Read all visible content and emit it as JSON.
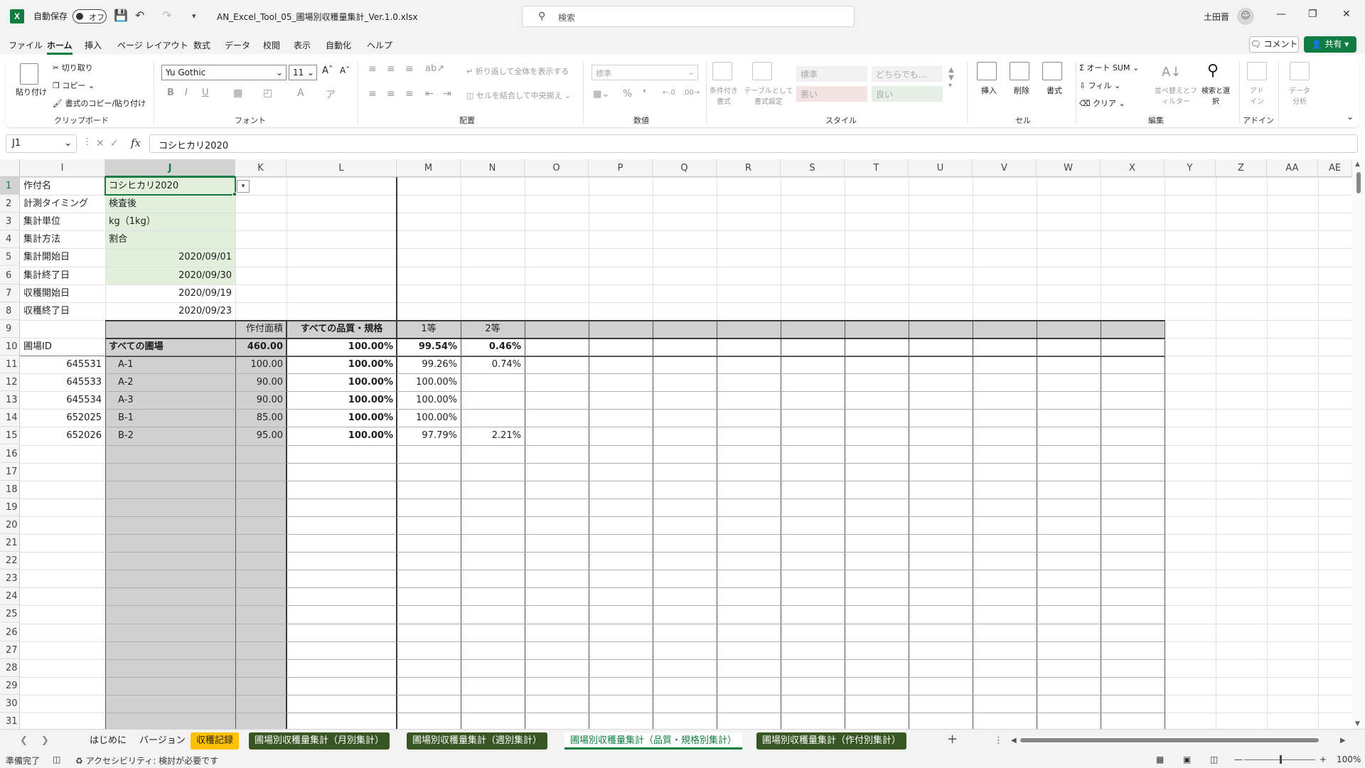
{
  "titlebar": {
    "autosave_label": "自動保存",
    "autosave_state": "オフ",
    "doc_title": "AN_Excel_Tool_05_圃場別収穫量集計_Ver.1.0.xlsx",
    "search_placeholder": "検索",
    "user_name": "土田晋"
  },
  "menu": [
    "ファイル",
    "ホーム",
    "挿入",
    "ページ レイアウト",
    "数式",
    "データ",
    "校閲",
    "表示",
    "自動化",
    "ヘルプ"
  ],
  "menu_active": "ホーム",
  "buttons": {
    "comment": "コメント",
    "share": "共有"
  },
  "ribbon": {
    "clipboard": {
      "paste": "貼り付け",
      "cut": "切り取り",
      "copy": "コピー",
      "format_painter": "書式のコピー/貼り付け",
      "label": "クリップボード"
    },
    "font": {
      "name": "Yu Gothic",
      "size": "11",
      "label": "フォント"
    },
    "alignment": {
      "wrap": "折り返して全体を表示する",
      "merge": "セルを結合して中央揃え",
      "label": "配置"
    },
    "number": {
      "format": "標準",
      "label": "数値"
    },
    "styles": {
      "conditional": "条件付き書式",
      "table": "テーブルとして書式設定",
      "standard": "標準",
      "neutral": "どちらでも...",
      "bad": "悪い",
      "good": "良い",
      "label": "スタイル"
    },
    "cells": {
      "insert": "挿入",
      "delete": "削除",
      "format": "書式",
      "label": "セル"
    },
    "editing": {
      "autosum": "オート SUM",
      "fill": "フィル",
      "clear": "クリア",
      "sort": "並べ替えとフィルター",
      "find": "検索と選択",
      "label": "編集"
    },
    "addins": {
      "addin": "アドイン",
      "label": "アドイン"
    },
    "analysis": {
      "data_analysis": "データ分析"
    }
  },
  "formula_bar": {
    "name_box": "J1",
    "formula": "コシヒカリ2020"
  },
  "columns": [
    "I",
    "J",
    "K",
    "L",
    "M",
    "N",
    "O",
    "P",
    "Q",
    "R",
    "S",
    "T",
    "U",
    "V",
    "W",
    "X",
    "Y",
    "Z",
    "AA",
    "AE"
  ],
  "rows": [
    "1",
    "2",
    "3",
    "4",
    "5",
    "6",
    "7",
    "8",
    "9",
    "10",
    "11",
    "12",
    "13",
    "14",
    "15",
    "16",
    "17",
    "18",
    "19",
    "20",
    "21",
    "22",
    "23",
    "24",
    "25",
    "26",
    "27",
    "28",
    "29",
    "30",
    "31"
  ],
  "sheet": {
    "params": [
      {
        "label": "作付名",
        "value": "コシヒカリ2020"
      },
      {
        "label": "計測タイミング",
        "value": "検査後"
      },
      {
        "label": "集計単位",
        "value": "kg（1kg）"
      },
      {
        "label": "集計方法",
        "value": "割合"
      },
      {
        "label": "集計開始日",
        "value": "2020/09/01"
      },
      {
        "label": "集計終了日",
        "value": "2020/09/30"
      },
      {
        "label": "収穫開始日",
        "value": "2020/09/19"
      },
      {
        "label": "収穫終了日",
        "value": "2020/09/23"
      }
    ],
    "header_row9": {
      "area": "作付面積",
      "all_quality": "すべての品質・規格",
      "grade1": "1等",
      "grade2": "2等"
    },
    "total_row": {
      "id_label": "圃場ID",
      "name": "すべての圃場",
      "area": "460.00",
      "all": "100.00%",
      "grade1": "99.54%",
      "grade2": "0.46%"
    },
    "fields": [
      {
        "id": "645531",
        "name": "A-1",
        "area": "100.00",
        "all": "100.00%",
        "grade1": "99.26%",
        "grade2": "0.74%"
      },
      {
        "id": "645533",
        "name": "A-2",
        "area": "90.00",
        "all": "100.00%",
        "grade1": "100.00%",
        "grade2": ""
      },
      {
        "id": "645534",
        "name": "A-3",
        "area": "90.00",
        "all": "100.00%",
        "grade1": "100.00%",
        "grade2": ""
      },
      {
        "id": "652025",
        "name": "B-1",
        "area": "85.00",
        "all": "100.00%",
        "grade1": "100.00%",
        "grade2": ""
      },
      {
        "id": "652026",
        "name": "B-2",
        "area": "95.00",
        "all": "100.00%",
        "grade1": "97.79%",
        "grade2": "2.21%"
      }
    ]
  },
  "tabs": [
    "はじめに",
    "バージョン",
    "収穫記録",
    "圃場別収穫量集計（月別集計）",
    "圃場別収穫量集計（週別集計）",
    "圃場別収穫量集計（品質・規格別集計）",
    "圃場別収穫量集計（作付別集計）"
  ],
  "status": {
    "ready": "準備完了",
    "accessibility": "アクセシビリティ: 検討が必要です",
    "zoom": "100%"
  },
  "colors": {
    "accent": "#107c41",
    "input_fill": "#e2efda",
    "gray_fill": "#d0d0d0",
    "tab_green": "#375623",
    "tab_yellow": "#ffc000"
  }
}
